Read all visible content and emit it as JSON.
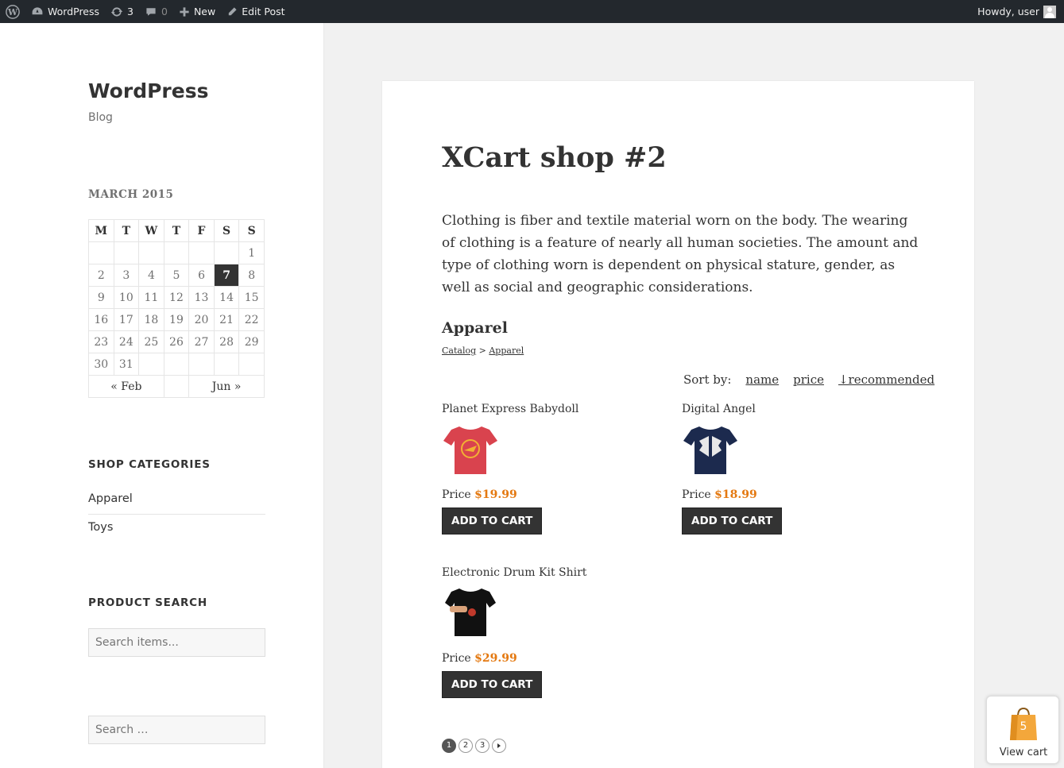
{
  "adminbar": {
    "site_name": "WordPress",
    "updates_count": "3",
    "comments_count": "0",
    "new_label": "New",
    "edit_label": "Edit Post",
    "howdy": "Howdy, user"
  },
  "sidebar": {
    "site_title": "WordPress",
    "site_description": "Blog",
    "calendar": {
      "caption": "MARCH 2015",
      "weekdays": [
        "M",
        "T",
        "W",
        "T",
        "F",
        "S",
        "S"
      ],
      "weeks": [
        [
          "",
          "",
          "",
          "",
          "",
          "",
          "1"
        ],
        [
          "2",
          "3",
          "4",
          "5",
          "6",
          "7",
          "8"
        ],
        [
          "9",
          "10",
          "11",
          "12",
          "13",
          "14",
          "15"
        ],
        [
          "16",
          "17",
          "18",
          "19",
          "20",
          "21",
          "22"
        ],
        [
          "23",
          "24",
          "25",
          "26",
          "27",
          "28",
          "29"
        ],
        [
          "30",
          "31",
          "",
          "",
          "",
          "",
          ""
        ]
      ],
      "today": "7",
      "prev": "« Feb",
      "next": "Jun »"
    },
    "shop_categories_title": "SHOP CATEGORIES",
    "categories": [
      "Apparel",
      "Toys"
    ],
    "product_search_title": "PRODUCT SEARCH",
    "product_search_placeholder": "Search items...",
    "search_placeholder": "Search …"
  },
  "article": {
    "title": "XCart shop #2",
    "content": "Clothing is fiber and textile material worn on the body. The wearing of clothing is a feature of nearly all human societies. The amount and type of clothing worn is dependent on physical stature, gender, as well as social and geographic considerations.",
    "category_heading": "Apparel",
    "breadcrumb": {
      "catalog": "Catalog",
      "sep": ">",
      "current": "Apparel"
    },
    "sort": {
      "label": "Sort by:",
      "name": "name",
      "price": "price",
      "recommended": "↓recommended"
    },
    "products": [
      {
        "name": "Planet Express Babydoll",
        "price_label": "Price",
        "price": "$19.99",
        "button": "ADD TO CART",
        "shirt_color": "#d9434e"
      },
      {
        "name": "Digital Angel",
        "price_label": "Price",
        "price": "$18.99",
        "button": "ADD TO CART",
        "shirt_color": "#1c2a4e"
      },
      {
        "name": "Electronic Drum Kit Shirt",
        "price_label": "Price",
        "price": "$29.99",
        "button": "ADD TO CART",
        "shirt_color": "#111111"
      }
    ],
    "pages": [
      "1",
      "2",
      "3"
    ]
  },
  "cart": {
    "count": "5",
    "label": "View cart"
  }
}
